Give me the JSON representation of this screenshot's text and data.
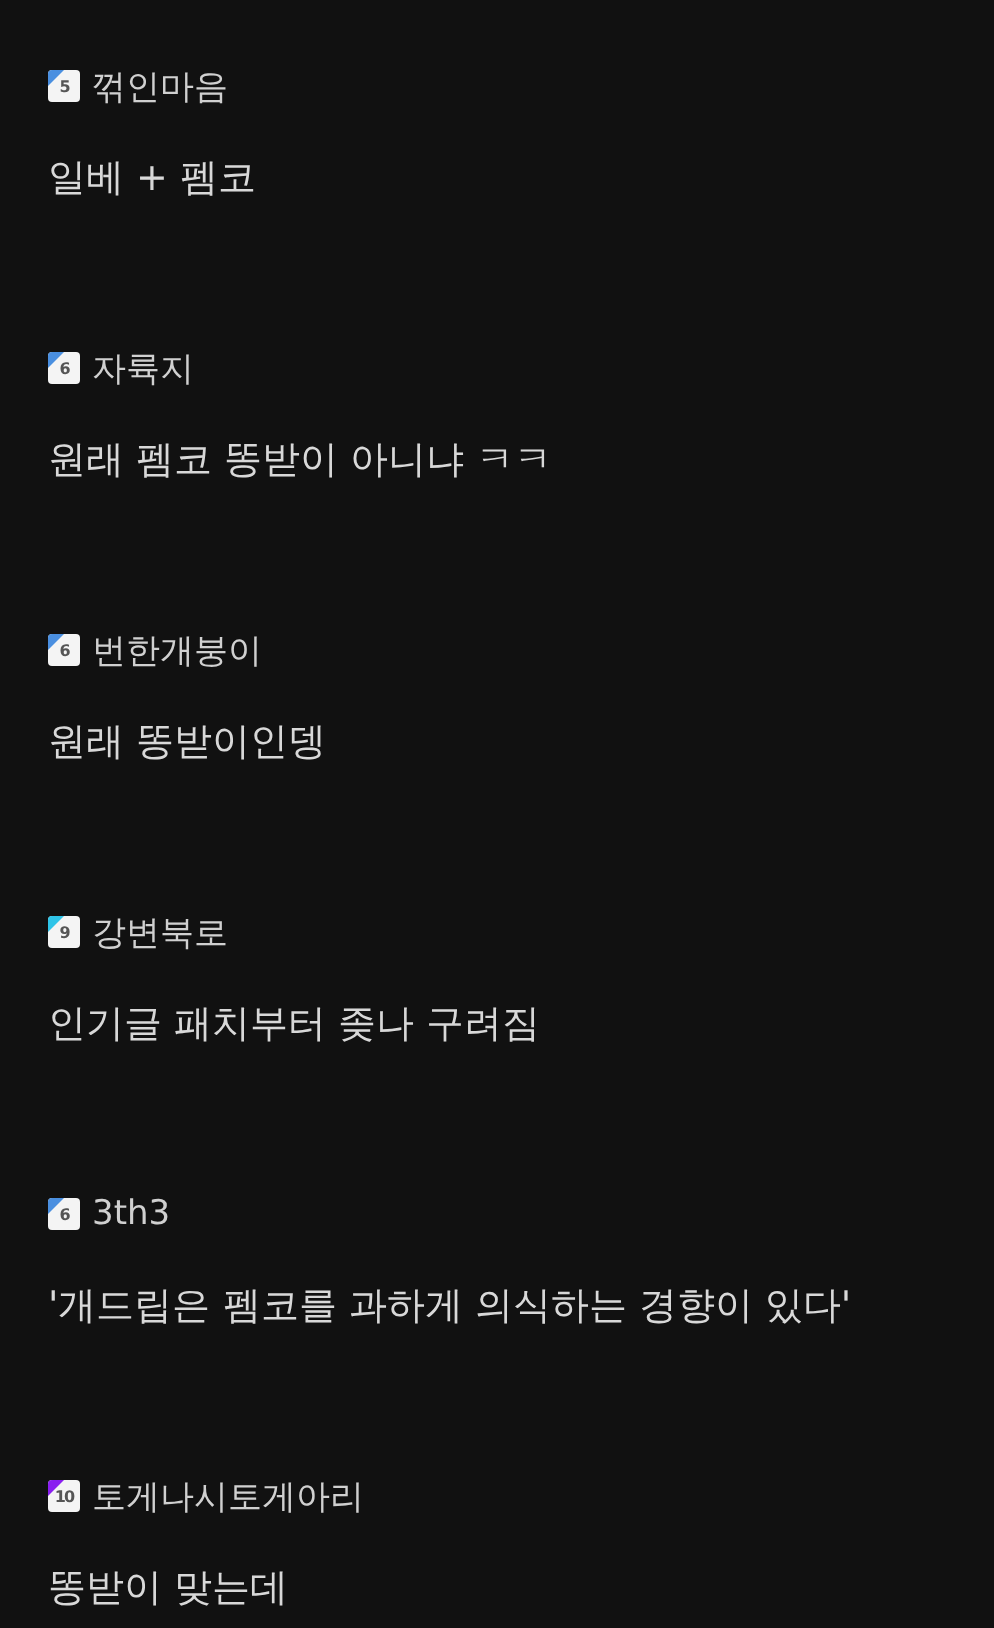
{
  "comments": [
    {
      "level": "5",
      "color": "#4a8fe0",
      "author": "꺾인마음",
      "text": "일베 + 펨코"
    },
    {
      "level": "6",
      "color": "#4a8fe0",
      "author": "자륙지",
      "text": "원래 펨코 똥받이 아니냐 ㅋㅋ"
    },
    {
      "level": "6",
      "color": "#4a8fe0",
      "author": "번한개붕이",
      "text": "원래 똥받이인뎅"
    },
    {
      "level": "9",
      "color": "#2ec4e8",
      "author": "강변북로",
      "text": "인기글 패치부터 좆나 구려짐"
    },
    {
      "level": "6",
      "color": "#4a8fe0",
      "author": "3th3",
      "text": "'개드립은 펨코를 과하게 의식하는 경향이 있다'"
    },
    {
      "level": "10",
      "color": "#8a1ef0",
      "author": "토게나시토게아리",
      "text": "똥받이 맞는데"
    }
  ]
}
